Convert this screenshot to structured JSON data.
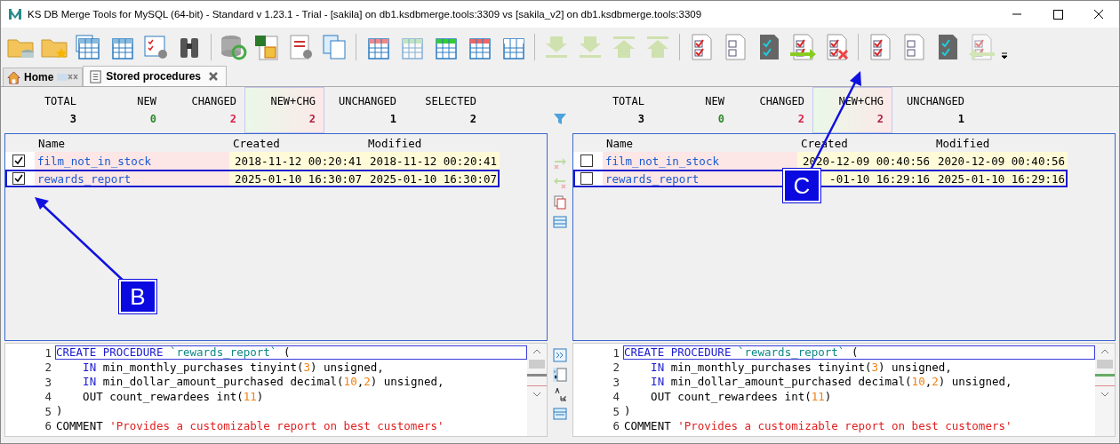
{
  "window": {
    "title": "KS DB Merge Tools for MySQL (64-bit) - Standard v 1.23.1 - Trial - [sakila] on db1.ksdbmerge.tools:3309 vs [sakila_v2] on db1.ksdbmerge.tools:3309"
  },
  "tabs": [
    {
      "label": "Home",
      "kind": "home",
      "selected": false
    },
    {
      "label": "Stored procedures",
      "kind": "doc",
      "selected": true
    }
  ],
  "panels": [
    {
      "stats": [
        {
          "label": "TOTAL",
          "value": "3",
          "kind": "total"
        },
        {
          "label": "NEW",
          "value": "0",
          "kind": "new"
        },
        {
          "label": "CHANGED",
          "value": "2",
          "kind": "changed"
        },
        {
          "label": "NEW+CHG",
          "value": "2",
          "kind": "newchg"
        },
        {
          "label": "UNCHANGED",
          "value": "1",
          "kind": "unchanged"
        },
        {
          "label": "SELECTED",
          "value": "2",
          "kind": "selected"
        }
      ],
      "columns": [
        "Name",
        "Created",
        "Modified"
      ],
      "rows": [
        {
          "checked": true,
          "selected": false,
          "name": "film_not_in_stock",
          "created": "2018-11-12 00:20:41",
          "modified": "2018-11-12 00:20:41"
        },
        {
          "checked": true,
          "selected": true,
          "name": "rewards_report",
          "created": "2025-01-10 16:30:07",
          "modified": "2025-01-10 16:30:07"
        }
      ]
    },
    {
      "stats": [
        {
          "label": "TOTAL",
          "value": "3",
          "kind": "total"
        },
        {
          "label": "NEW",
          "value": "0",
          "kind": "new"
        },
        {
          "label": "CHANGED",
          "value": "2",
          "kind": "changed"
        },
        {
          "label": "NEW+CHG",
          "value": "2",
          "kind": "newchg"
        },
        {
          "label": "UNCHANGED",
          "value": "1",
          "kind": "unchanged"
        }
      ],
      "columns": [
        "Name",
        "Created",
        "Modified"
      ],
      "rows": [
        {
          "checked": false,
          "selected": false,
          "name": "film_not_in_stock",
          "created": "2020-12-09 00:40:56",
          "modified": "2020-12-09 00:40:56"
        },
        {
          "checked": false,
          "selected": true,
          "name": "rewards_report",
          "created": "-01-10 16:29:16",
          "modified": "2025-01-10 16:29:16"
        }
      ]
    }
  ],
  "editors": [
    {
      "lines": [
        {
          "number": "1",
          "tokens": [
            {
              "kind": "keyword",
              "text": "CREATE PROCEDURE"
            },
            {
              "kind": "ident",
              "text": " `rewards_report`"
            },
            {
              "kind": "plain",
              "text": " ("
            }
          ]
        },
        {
          "number": "2",
          "tokens": [
            {
              "kind": "keyword",
              "text": "    IN"
            },
            {
              "kind": "plain",
              "text": " min_monthly_purchases tinyint("
            },
            {
              "kind": "number",
              "text": "3"
            },
            {
              "kind": "plain",
              "text": ") unsigned,"
            }
          ]
        },
        {
          "number": "3",
          "tokens": [
            {
              "kind": "keyword",
              "text": "    IN"
            },
            {
              "kind": "plain",
              "text": " min_dollar_amount_purchased decimal("
            },
            {
              "kind": "number",
              "text": "10"
            },
            {
              "kind": "plain",
              "text": ","
            },
            {
              "kind": "number",
              "text": "2"
            },
            {
              "kind": "plain",
              "text": ") unsigned,"
            }
          ]
        },
        {
          "number": "4",
          "tokens": [
            {
              "kind": "plain",
              "text": "    OUT count_rewardees int("
            },
            {
              "kind": "number",
              "text": "11"
            },
            {
              "kind": "plain",
              "text": ")"
            }
          ]
        },
        {
          "number": "5",
          "tokens": [
            {
              "kind": "plain",
              "text": ")"
            }
          ]
        },
        {
          "number": "6",
          "tokens": [
            {
              "kind": "plain",
              "text": "COMMENT "
            },
            {
              "kind": "string",
              "text": "'Provides a customizable report on best customers'"
            }
          ]
        }
      ]
    },
    {
      "lines": [
        {
          "number": "1",
          "tokens": [
            {
              "kind": "keyword",
              "text": "CREATE PROCEDURE"
            },
            {
              "kind": "ident",
              "text": " `rewards_report`"
            },
            {
              "kind": "plain",
              "text": " ("
            }
          ]
        },
        {
          "number": "2",
          "tokens": [
            {
              "kind": "keyword",
              "text": "    IN"
            },
            {
              "kind": "plain",
              "text": " min_monthly_purchases tinyint("
            },
            {
              "kind": "number",
              "text": "3"
            },
            {
              "kind": "plain",
              "text": ") unsigned,"
            }
          ]
        },
        {
          "number": "3",
          "tokens": [
            {
              "kind": "keyword",
              "text": "    IN"
            },
            {
              "kind": "plain",
              "text": " min_dollar_amount_purchased decimal("
            },
            {
              "kind": "number",
              "text": "10"
            },
            {
              "kind": "plain",
              "text": ","
            },
            {
              "kind": "number",
              "text": "2"
            },
            {
              "kind": "plain",
              "text": ") unsigned,"
            }
          ]
        },
        {
          "number": "4",
          "tokens": [
            {
              "kind": "plain",
              "text": "    OUT count_rewardees int("
            },
            {
              "kind": "number",
              "text": "11"
            },
            {
              "kind": "plain",
              "text": ")"
            }
          ]
        },
        {
          "number": "5",
          "tokens": [
            {
              "kind": "plain",
              "text": ")"
            }
          ]
        },
        {
          "number": "6",
          "tokens": [
            {
              "kind": "plain",
              "text": "COMMENT "
            },
            {
              "kind": "string",
              "text": "'Provides a customizable report on best customers'"
            }
          ]
        }
      ]
    }
  ],
  "callouts": [
    {
      "label": "B",
      "kind": "left"
    },
    {
      "label": "C",
      "kind": "right"
    }
  ]
}
